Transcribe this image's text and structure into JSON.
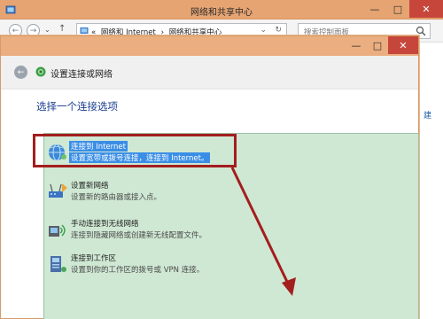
{
  "window": {
    "title": "网络和共享中心",
    "controls": {
      "minimize": "—",
      "maximize": "□",
      "close": "✕"
    }
  },
  "nav": {
    "back": "←",
    "forward": "→",
    "recent": "⌄",
    "up": "↑",
    "address_chevron": "«",
    "breadcrumb_1": "网络和 Internet",
    "breadcrumb_sep": "›",
    "breadcrumb_2": "网络和共享中心",
    "dropdown": "⌄",
    "refresh": "↻",
    "search_placeholder": "搜索控制面板"
  },
  "side_link": "建",
  "dialog": {
    "controls": {
      "minimize": "—",
      "maximize": "□",
      "close": "✕"
    },
    "back": "←",
    "title": "设置连接或网络",
    "instruction": "选择一个连接选项",
    "options": [
      {
        "title": "连接到 Internet",
        "desc": "设置宽带或拨号连接，连接到 Internet。",
        "icon": "globe-icon"
      },
      {
        "title": "设置新网络",
        "desc": "设置新的路由器或接入点。",
        "icon": "router-icon"
      },
      {
        "title": "手动连接到无线网络",
        "desc": "连接到隐藏网络或创建新无线配置文件。",
        "icon": "wireless-icon"
      },
      {
        "title": "连接到工作区",
        "desc": "设置到你的工作区的拨号或 VPN 连接。",
        "icon": "workplace-icon"
      }
    ]
  },
  "colors": {
    "accent_titlebar": "#e6a472",
    "selection": "#3a8ee6",
    "highlight_annotation": "#a31e1e",
    "options_background": "#cfe8d3"
  }
}
